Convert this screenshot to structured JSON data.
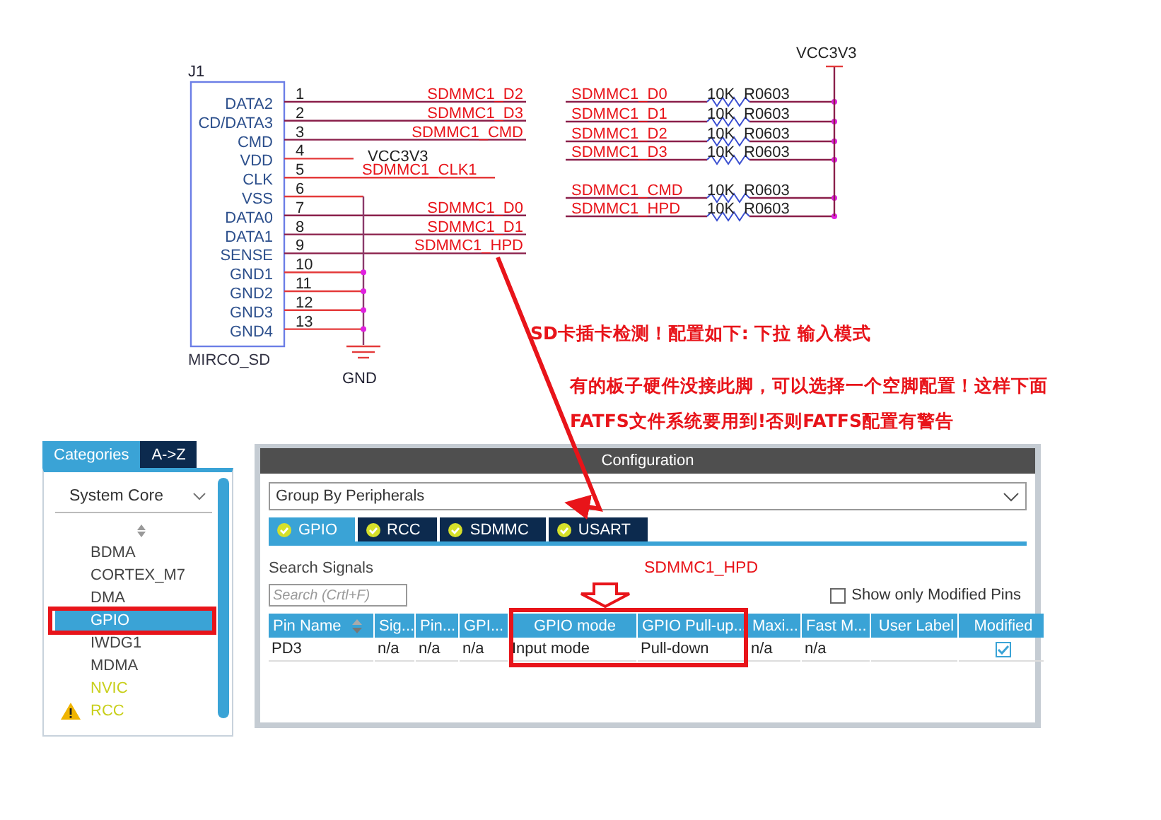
{
  "schematic": {
    "connector": {
      "ref": "J1",
      "part": "MIRCO_SD",
      "pins": [
        {
          "number": "1",
          "name": "DATA2",
          "net": "SDMMC1_D2",
          "kind": "net"
        },
        {
          "number": "2",
          "name": "CD/DATA3",
          "net": "SDMMC1_D3",
          "kind": "net"
        },
        {
          "number": "3",
          "name": "CMD",
          "net": "SDMMC1_CMD",
          "kind": "net"
        },
        {
          "number": "4",
          "name": "VDD",
          "net": "VCC3V3",
          "kind": "power"
        },
        {
          "number": "5",
          "name": "CLK",
          "net": "SDMMC1_CLK1",
          "kind": "short"
        },
        {
          "number": "6",
          "name": "VSS",
          "kind": "ground"
        },
        {
          "number": "7",
          "name": "DATA0",
          "net": "SDMMC1_D0",
          "kind": "net"
        },
        {
          "number": "8",
          "name": "DATA1",
          "net": "SDMMC1_D1",
          "kind": "net"
        },
        {
          "number": "9",
          "name": "SENSE",
          "net": "SDMMC1_HPD",
          "kind": "net"
        },
        {
          "number": "10",
          "name": "GND1",
          "kind": "ground"
        },
        {
          "number": "11",
          "name": "GND2",
          "kind": "ground"
        },
        {
          "number": "12",
          "name": "GND3",
          "kind": "ground"
        },
        {
          "number": "13",
          "name": "GND4",
          "kind": "ground"
        }
      ],
      "ground_label": "GND"
    },
    "pullups": {
      "supply": "VCC3V3",
      "resistors": [
        {
          "net": "SDMMC1_D0",
          "value": "10K",
          "footprint": "R0603"
        },
        {
          "net": "SDMMC1_D1",
          "value": "10K",
          "footprint": "R0603"
        },
        {
          "net": "SDMMC1_D2",
          "value": "10K",
          "footprint": "R0603"
        },
        {
          "net": "SDMMC1_D3",
          "value": "10K",
          "footprint": "R0603"
        },
        {
          "net": "SDMMC1_CMD",
          "value": "10K",
          "footprint": "R0603"
        },
        {
          "net": "SDMMC1_HPD",
          "value": "10K",
          "footprint": "R0603"
        }
      ]
    }
  },
  "annotations": [
    "SD卡插卡检测！配置如下: 下拉 输入模式",
    "有的板子硬件没接此脚，可以选择一个空脚配置！这样下面",
    "FATFS文件系统要用到!否则FATFS配置有警告"
  ],
  "sidebar": {
    "tabs": [
      {
        "label": "Categories",
        "selected": true
      },
      {
        "label": "A->Z",
        "selected": false
      }
    ],
    "category": "System Core",
    "items": [
      {
        "label": "BDMA",
        "selected": false,
        "kind": "plain",
        "highlighted": false
      },
      {
        "label": "CORTEX_M7",
        "selected": false,
        "kind": "plain",
        "highlighted": false
      },
      {
        "label": "DMA",
        "selected": false,
        "kind": "plain",
        "highlighted": false
      },
      {
        "label": "GPIO",
        "selected": true,
        "kind": "plain",
        "highlighted": true
      },
      {
        "label": "IWDG1",
        "selected": false,
        "kind": "plain",
        "highlighted": false
      },
      {
        "label": "MDMA",
        "selected": false,
        "kind": "plain",
        "highlighted": false
      },
      {
        "label": "NVIC",
        "selected": false,
        "kind": "partial",
        "highlighted": false
      },
      {
        "label": "RCC",
        "selected": false,
        "kind": "warning",
        "highlighted": false
      }
    ]
  },
  "configuration": {
    "title": "Configuration",
    "group_by": "Group By Peripherals",
    "tabs": [
      {
        "label": "GPIO",
        "selected": true
      },
      {
        "label": "RCC",
        "selected": false
      },
      {
        "label": "SDMMC",
        "selected": false
      },
      {
        "label": "USART",
        "selected": false
      }
    ],
    "search_label": "Search Signals",
    "search": {
      "placeholder": "Search (Crtl+F)"
    },
    "pin_note": "SDMMC1_HPD",
    "show_modified": {
      "label": "Show only Modified Pins",
      "checked": false
    },
    "table": {
      "columns": [
        {
          "label": "Pin Name",
          "sortable": true,
          "highlighted": false
        },
        {
          "label": "Sig...",
          "sortable": false,
          "highlighted": false
        },
        {
          "label": "Pin...",
          "sortable": false,
          "highlighted": false
        },
        {
          "label": "GPI...",
          "sortable": false,
          "highlighted": false
        },
        {
          "label": "GPIO mode",
          "sortable": false,
          "highlighted": true
        },
        {
          "label": "GPIO Pull-up...",
          "sortable": false,
          "highlighted": true
        },
        {
          "label": "Maxi...",
          "sortable": false,
          "highlighted": false
        },
        {
          "label": "Fast M...",
          "sortable": false,
          "highlighted": false
        },
        {
          "label": "User Label",
          "sortable": false,
          "highlighted": false
        },
        {
          "label": "Modified",
          "sortable": false,
          "highlighted": false
        }
      ],
      "rows": [
        {
          "cells": [
            "PD3",
            "n/a",
            "n/a",
            "n/a",
            "Input mode",
            "Pull-down",
            "n/a",
            "n/a"
          ],
          "modified": true
        }
      ]
    }
  }
}
